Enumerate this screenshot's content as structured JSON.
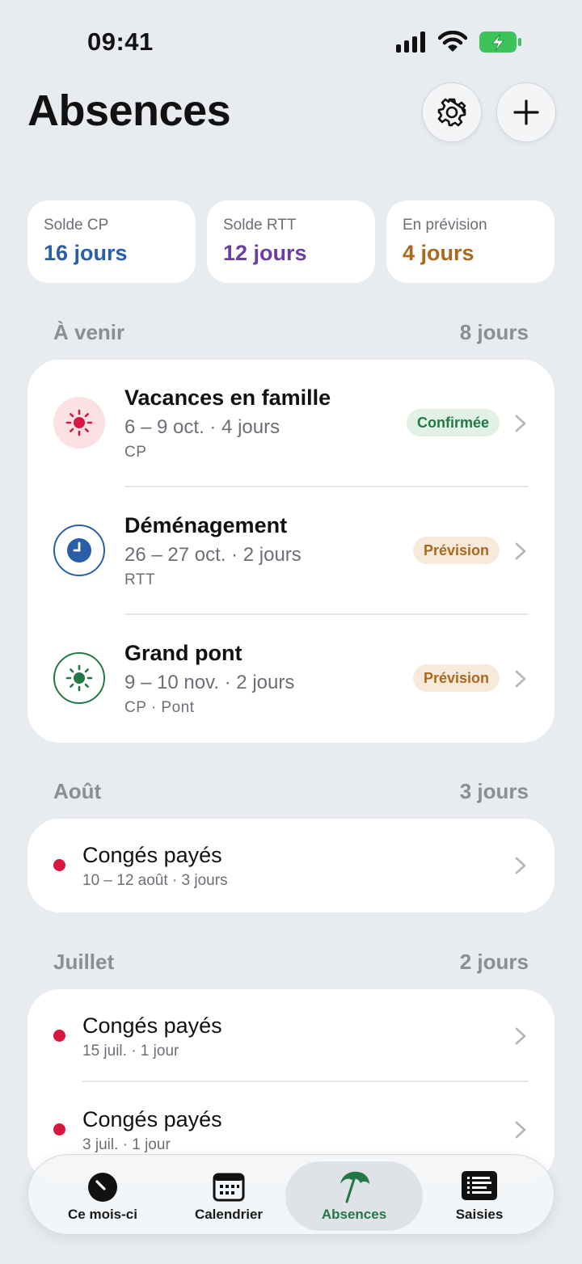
{
  "status_bar": {
    "time": "09:41"
  },
  "header": {
    "title": "Absences"
  },
  "summary": [
    {
      "label": "Solde CP",
      "value": "16 jours",
      "color": "#2a5fa8"
    },
    {
      "label": "Solde RTT",
      "value": "12 jours",
      "color": "#6a3fa0"
    },
    {
      "label": "En prévision",
      "value": "4 jours",
      "color": "#a9691f"
    }
  ],
  "sections": {
    "upcoming": {
      "label": "À venir",
      "total": "8 jours",
      "items": [
        {
          "title": "Vacances en famille",
          "dates": "6 – 9 oct. · 4 jours",
          "tag": "CP",
          "status": "Confirmée",
          "icon": "sun-icon"
        },
        {
          "title": "Déménagement",
          "dates": "26 – 27 oct. · 2 jours",
          "tag": "RTT",
          "status": "Prévision",
          "icon": "clock-icon"
        },
        {
          "title": "Grand pont",
          "dates": "9 – 10 nov. · 2 jours",
          "tag": "CP · Pont",
          "status": "Prévision",
          "icon": "sun-icon"
        }
      ]
    },
    "august": {
      "label": "Août",
      "total": "3 jours",
      "items": [
        {
          "title": "Congés payés",
          "dates": "10 – 12 août · 3 jours"
        }
      ]
    },
    "july": {
      "label": "Juillet",
      "total": "2 jours",
      "items": [
        {
          "title": "Congés payés",
          "dates": "15 juil. · 1 jour"
        },
        {
          "title": "Congés payés",
          "dates": "3 juil. · 1 jour"
        }
      ]
    }
  },
  "tabs": [
    {
      "label": "Ce mois-ci",
      "icon": "gauge-icon"
    },
    {
      "label": "Calendrier",
      "icon": "calendar-icon"
    },
    {
      "label": "Absences",
      "icon": "umbrella-icon",
      "active": true
    },
    {
      "label": "Saisies",
      "icon": "list-icon"
    }
  ],
  "colors": {
    "accent_green": "#237845",
    "dot_red": "#d6173f"
  }
}
